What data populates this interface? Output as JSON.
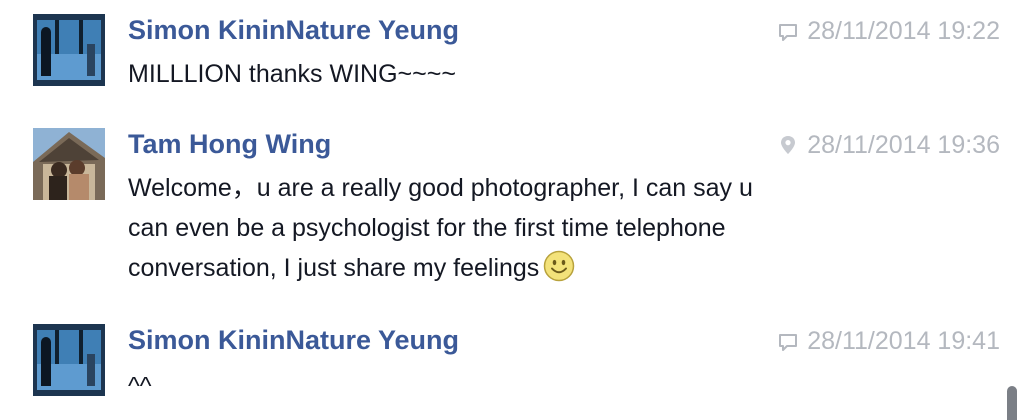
{
  "messages": [
    {
      "sender": "Simon KininNature Yeung",
      "timestamp": "28/11/2014 19:22",
      "meta_icon": "chat-bubble-icon",
      "lines": [
        "MILLLION thanks WING~~~~"
      ]
    },
    {
      "sender": "Tam Hong Wing",
      "timestamp": "28/11/2014 19:36",
      "meta_icon": "location-pin-icon",
      "lines": [
        "Welcome，u are a really good photographer, I can say u",
        "can even be a psychologist for the first time telephone",
        "conversation, I just share my feelings"
      ],
      "emoji": "smiley-emoji"
    },
    {
      "sender": "Simon KininNature Yeung",
      "timestamp": "28/11/2014 19:41",
      "meta_icon": "chat-bubble-icon",
      "lines": [
        "^^"
      ]
    }
  ],
  "colors": {
    "sender": "#3b5998",
    "timestamp": "#b4b8bf",
    "body": "#141823",
    "scrollbar_thumb": "#7b7f86"
  }
}
